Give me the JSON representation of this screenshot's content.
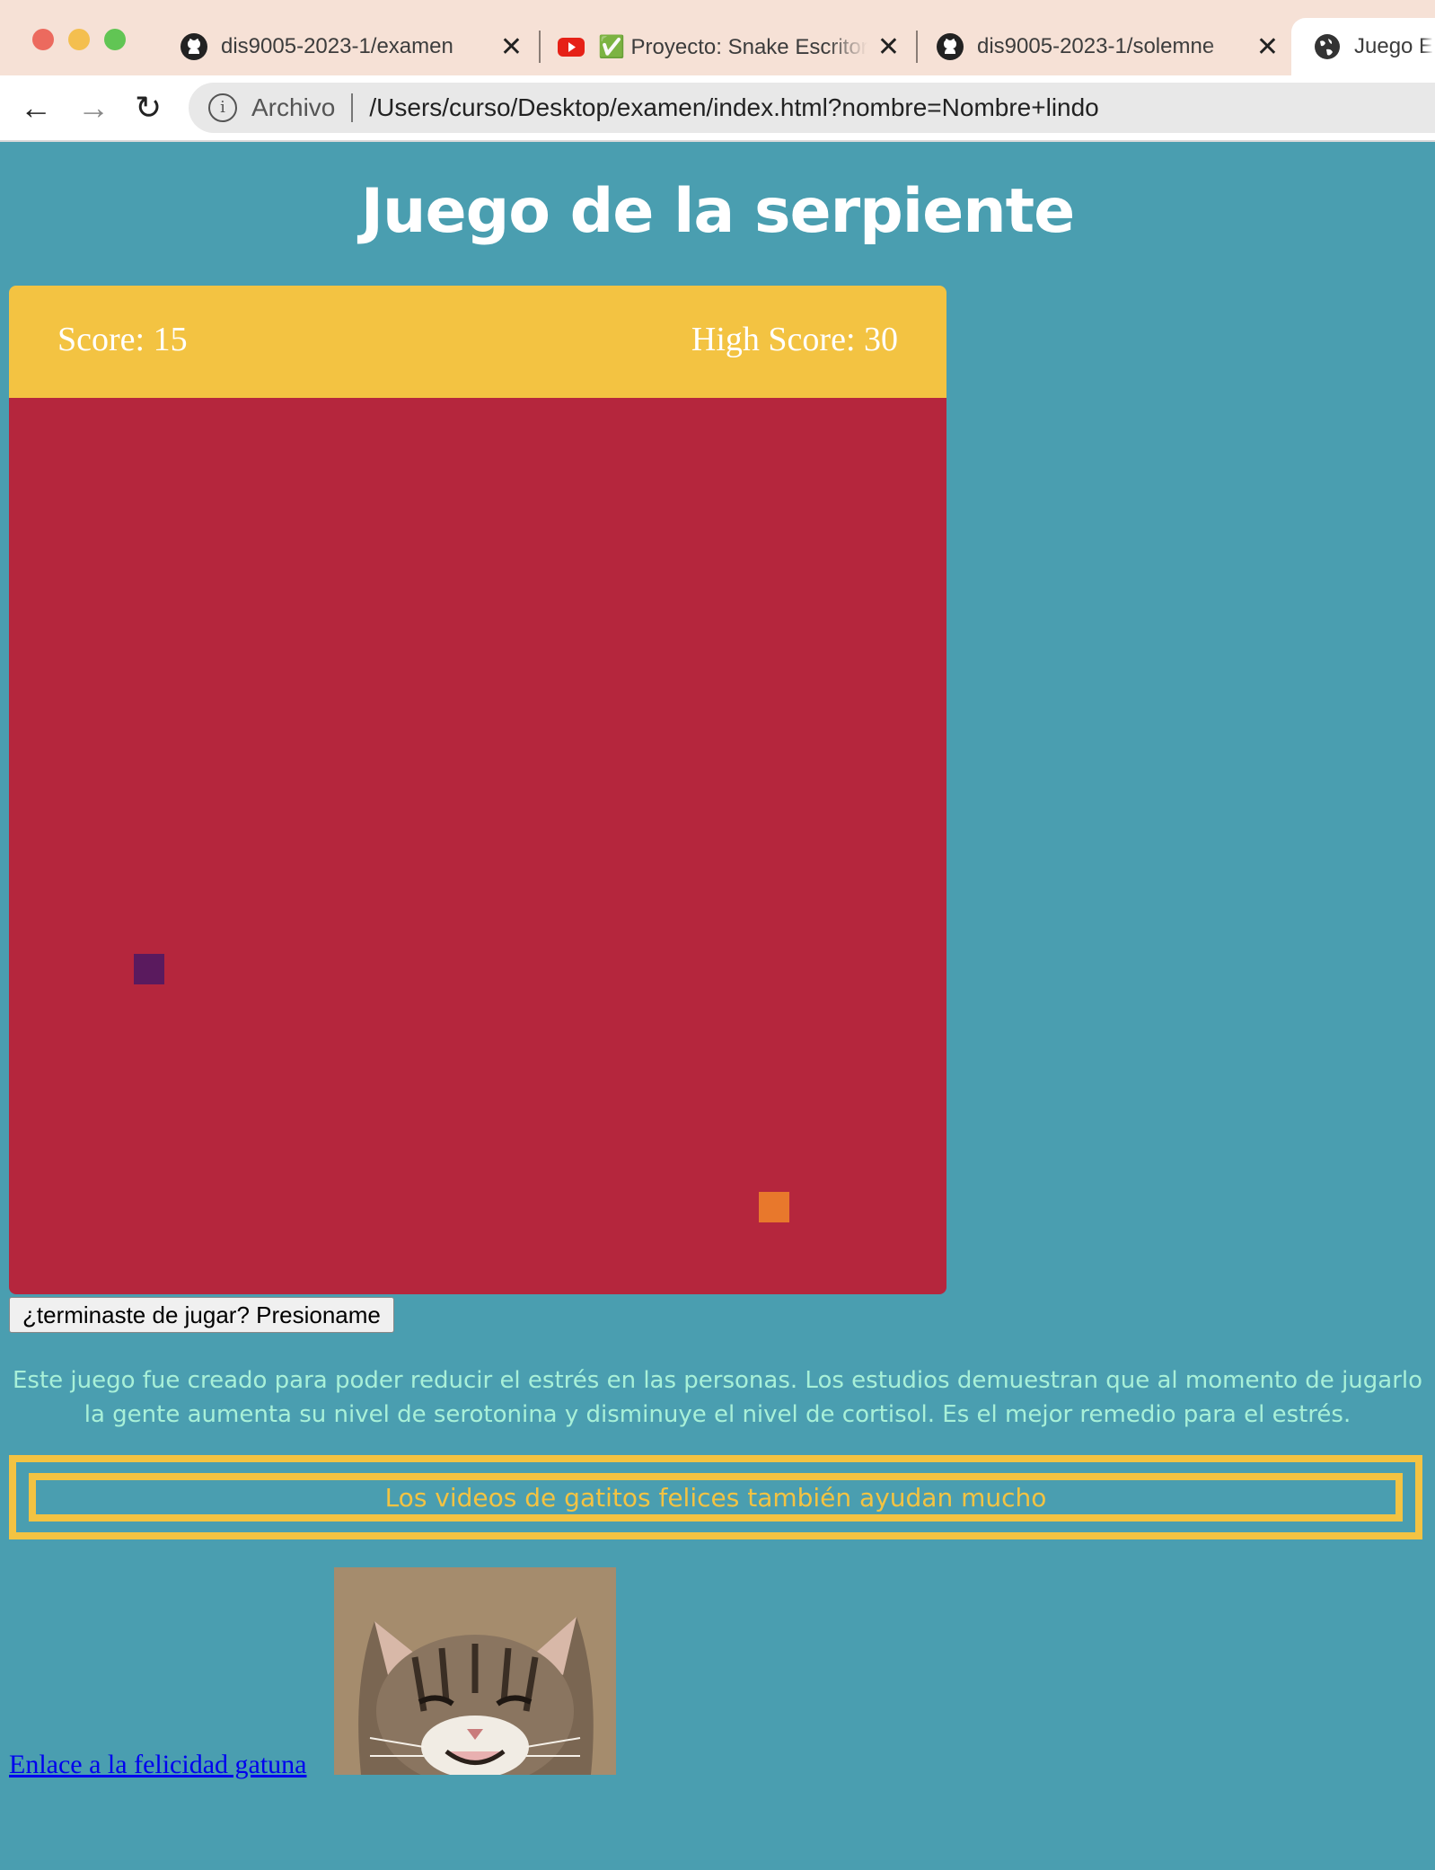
{
  "browser": {
    "tabs": [
      {
        "title": "dis9005-2023-1/examen",
        "icon": "github-icon"
      },
      {
        "title": "✅ Proyecto: Snake Escritorio",
        "icon": "youtube-icon"
      },
      {
        "title": "dis9005-2023-1/solemne",
        "icon": "github-icon"
      },
      {
        "title": "Juego E",
        "icon": "globe-icon"
      }
    ],
    "address": {
      "label": "Archivo",
      "url": "/Users/curso/Desktop/examen/index.html?nombre=Nombre+lindo"
    }
  },
  "page": {
    "title": "Juego de la serpiente",
    "score_label": "Score: 15",
    "high_score_label": "High Score: 30",
    "finish_button": "¿terminaste de jugar? Presioname",
    "description": "Este juego fue creado para poder reducir el estrés en las personas. Los estudios demuestran que al momento de jugarlo la gente aumenta su nivel de serotonina y disminuye el nivel de cortisol. Es el mejor remedio para el estrés.",
    "banner": "Los videos de gatitos felices también ayudan mucho",
    "cat_link": "Enlace a la felicidad gatuna"
  },
  "colors": {
    "background": "#4a9eb0",
    "scorebar": "#f3c342",
    "board": "#b5263d",
    "snake": "#5a1a5e",
    "food": "#e8782c",
    "description_text": "#a8f0d8"
  }
}
